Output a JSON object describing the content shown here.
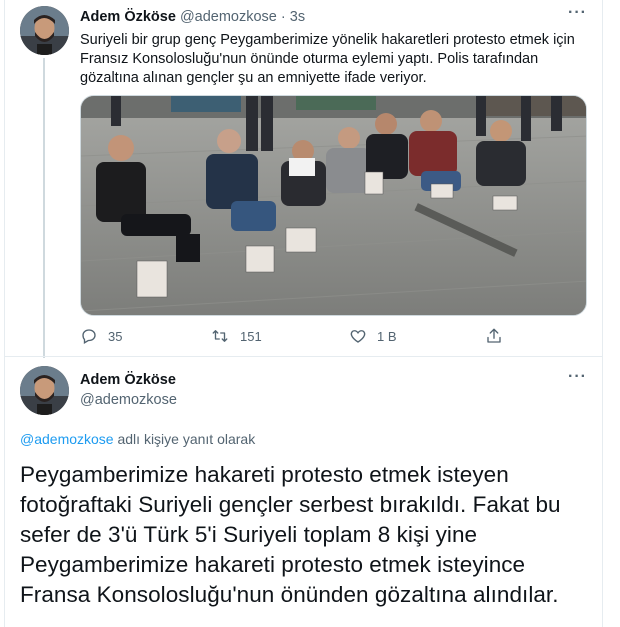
{
  "tweet1": {
    "author_name": "Adem Özköse",
    "author_handle": "@ademozkose",
    "separator": "·",
    "time": "3s",
    "text": "Suriyeli bir grup genç Peygamberimize yönelik hakaretleri protesto etmek için Fransız Konsolosluğu'nun önünde oturma eylemi yaptı. Polis tarafından gözaltına alınan gençler şu an emniyette ifade veriyor.",
    "more_icon": "more-dots-icon",
    "actions": {
      "reply_count": "35",
      "retweet_count": "151",
      "like_count": "1 B"
    }
  },
  "tweet2": {
    "author_name": "Adem Özköse",
    "author_handle": "@ademozkose",
    "reply_mention": "@ademozkose",
    "reply_suffix": " adlı kişiye yanıt olarak",
    "text": "Peygamberimize hakareti protesto etmek isteyen fotoğraftaki Suriyeli gençler serbest bırakıldı. Fakat bu sefer de 3'ü Türk 5'i Suriyeli toplam 8 kişi yine Peygamberimize hakareti protesto etmek isteyince Fransa Konsolosluğu'nun önünden gözaltına alındılar."
  },
  "colors": {
    "accent": "#1d9bf0",
    "secondary_text": "#536471",
    "border": "#e6ecf0"
  }
}
